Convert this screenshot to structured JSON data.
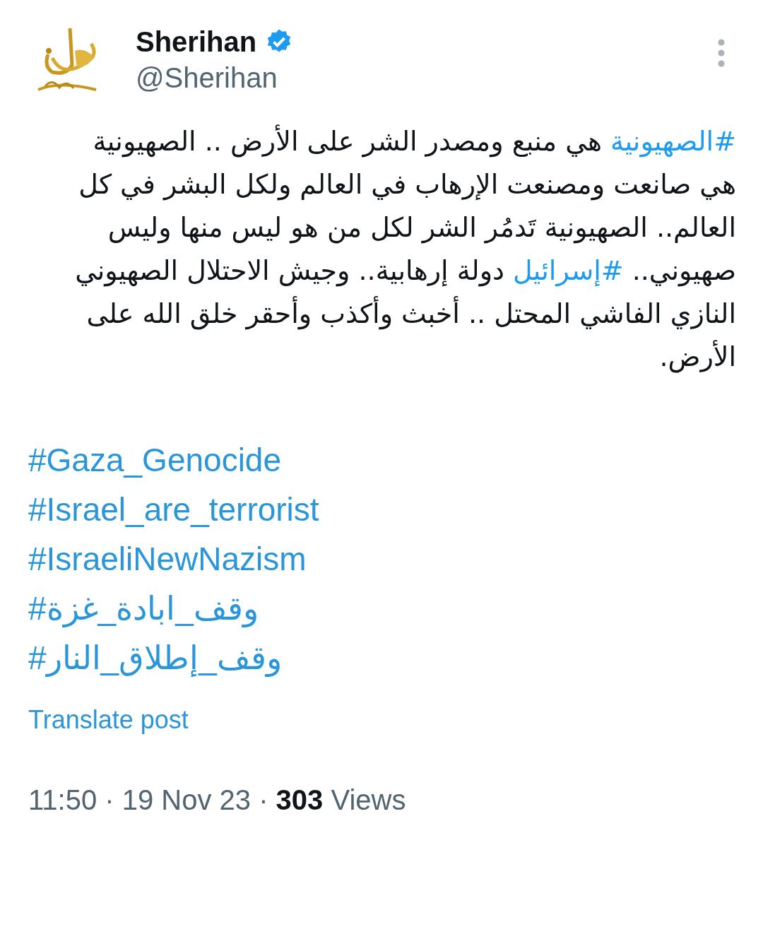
{
  "author": {
    "name": "Sherihan",
    "verified": true,
    "handle": "@Sherihan"
  },
  "body": [
    {
      "kind": "hashtag",
      "text": "#الصهيونية"
    },
    {
      "kind": "text",
      "text": " هي منبع ومصدر الشر على الأرض .. الصهيونية هي صانعت ومصنعت الإرهاب في العالم ولكل البشر في كل العالم.. الصهيونية تَدمُر الشر لكل من هو ليس منها وليس صهيوني.. "
    },
    {
      "kind": "hashtag",
      "text": "#إسرائيل"
    },
    {
      "kind": "text",
      "text": " دولة إرهابية.. وجيش الاحتلال الصهيوني النازي الفاشي المحتل .. أخبث وأكذب وأحقر خلق الله على الأرض."
    }
  ],
  "hashtags": [
    {
      "text": "#Gaza_Genocide"
    },
    {
      "text": "#Israel_are_terrorist"
    },
    {
      "text": "#IsraeliNewNazism"
    },
    {
      "text": "#وقف_ابادة_غزة"
    },
    {
      "text": "#وقف_إطلاق_النار"
    }
  ],
  "translate_link": "Translate post",
  "meta": "11:50 · 19 Nov 23 · **303** Views"
}
